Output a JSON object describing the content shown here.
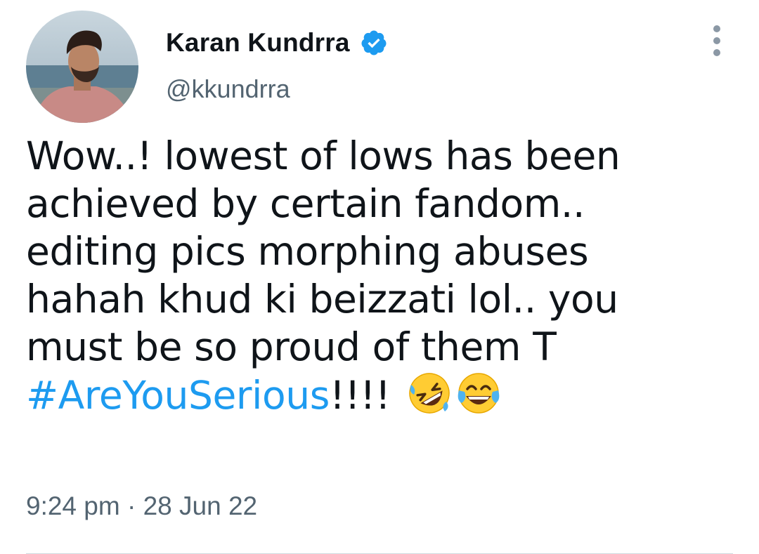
{
  "user": {
    "display_name": "Karan Kundrra",
    "handle": "@kkundrra",
    "verified": true,
    "avatar_icon": "profile-photo"
  },
  "tweet": {
    "lines": [
      "Wow..! lowest of lows has been",
      "achieved by certain fandom..",
      "editing pics morphing abuses",
      "hahah khud ki beizzati lol.. you",
      "must be so proud of them T"
    ],
    "hashtag": "#AreYouSerious",
    "trailing_text": "!!!!",
    "emojis": [
      "rolling-on-the-floor-laughing-emoji",
      "face-with-tears-of-joy-emoji"
    ]
  },
  "meta": {
    "time": "9:24 pm",
    "separator": " · ",
    "date": "28 Jun 22"
  },
  "colors": {
    "text": "#0f1419",
    "secondary": "#536471",
    "link": "#1d9bf0",
    "verified_badge": "#1d9bf0",
    "divider": "#cfd9de"
  },
  "icons": {
    "verified": "verified-badge-icon",
    "more": "more-options-icon"
  }
}
